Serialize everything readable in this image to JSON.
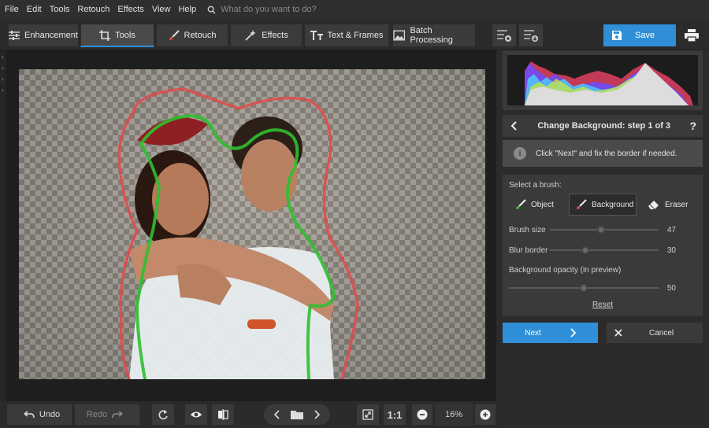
{
  "menu": {
    "items": [
      "File",
      "Edit",
      "Tools",
      "Retouch",
      "Effects",
      "View",
      "Help"
    ],
    "search_placeholder": "What do you want to do?"
  },
  "toolbar": {
    "tabs": [
      {
        "label": "Enhancement",
        "icon": "sliders-icon"
      },
      {
        "label": "Tools",
        "icon": "crop-icon"
      },
      {
        "label": "Retouch",
        "icon": "brush-icon"
      },
      {
        "label": "Effects",
        "icon": "magic-wand-icon"
      },
      {
        "label": "Text & Frames",
        "icon": "text-icon"
      },
      {
        "label": "Batch Processing",
        "icon": "image-stack-icon"
      }
    ],
    "active_tab": "Tools",
    "save_label": "Save"
  },
  "bottom": {
    "undo_label": "Undo",
    "redo_label": "Redo",
    "ratio_label": "1:1",
    "zoom_value": "16%"
  },
  "panel": {
    "step_title": "Change Background: step 1 of 3",
    "info_text": "Click \"Next\" and fix the border if needed.",
    "select_brush_label": "Select a brush:",
    "brushes": [
      {
        "label": "Object",
        "icon": "brush-icon"
      },
      {
        "label": "Background",
        "icon": "brush-icon",
        "active": true
      },
      {
        "label": "Eraser",
        "icon": "eraser-icon"
      }
    ],
    "brush_size": {
      "label": "Brush size",
      "value": "47"
    },
    "blur_border": {
      "label": "Blur border",
      "value": "30"
    },
    "bg_opacity": {
      "label": "Background opacity (in preview)",
      "value": "50"
    },
    "reset_label": "Reset",
    "next_label": "Next",
    "cancel_label": "Cancel"
  },
  "colors": {
    "accent": "#2f8fd8",
    "object_stroke": "#2fbf2f",
    "background_stroke": "#e04a4a"
  }
}
